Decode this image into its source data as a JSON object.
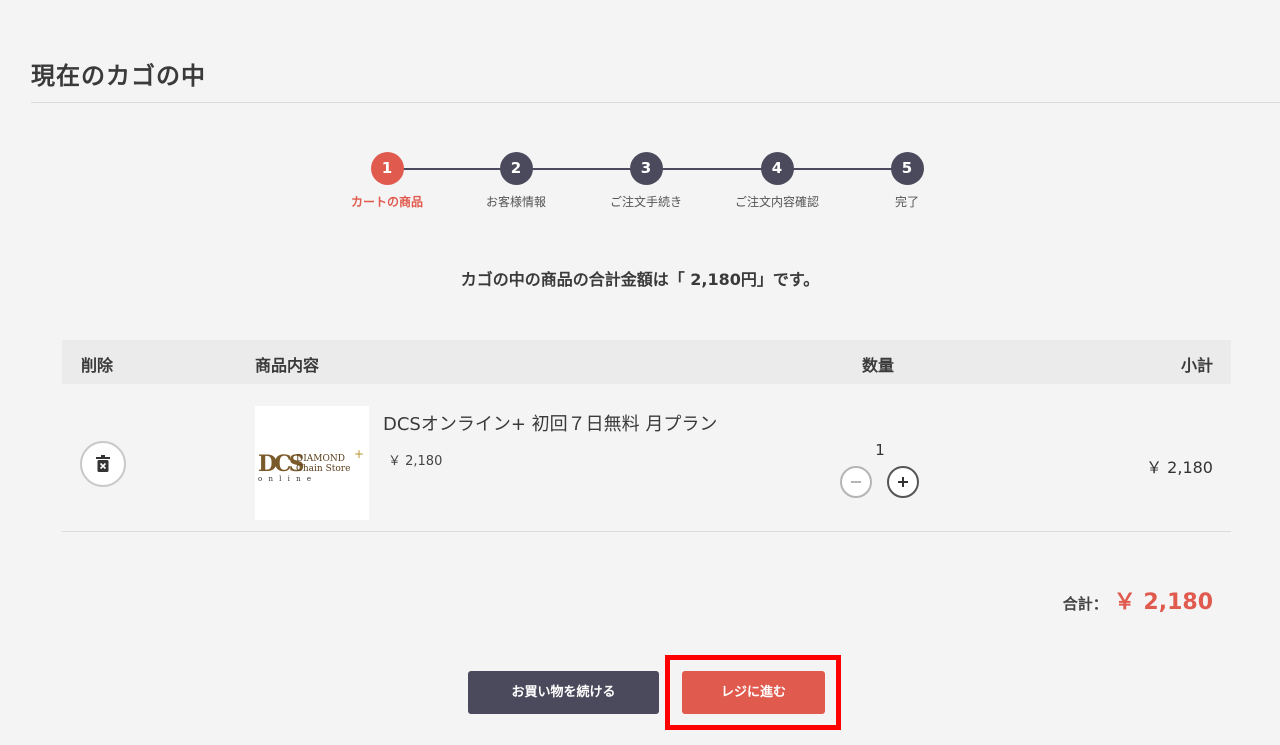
{
  "page": {
    "title": "現在のカゴの中"
  },
  "stepper": {
    "steps": [
      {
        "number": "1",
        "label": "カートの商品"
      },
      {
        "number": "2",
        "label": "お客様情報"
      },
      {
        "number": "3",
        "label": "ご注文手続き"
      },
      {
        "number": "4",
        "label": "ご注文内容確認"
      },
      {
        "number": "5",
        "label": "完了"
      }
    ],
    "active_step": 1
  },
  "summary_message": "カゴの中の商品の合計金額は「 2,180円」です。",
  "cart": {
    "headers": {
      "delete": "削除",
      "item": "商品内容",
      "quantity": "数量",
      "subtotal": "小計"
    },
    "items": [
      {
        "name": "DCSオンライン+ 初回７日無料 月プラン",
        "unit_price": "￥ 2,180",
        "quantity": "1",
        "subtotal": "￥ 2,180",
        "logo": {
          "brand": "DCS",
          "line1": "DIAMOND",
          "plus": "+",
          "line2": "Chain Store",
          "line3": "o n l i n e"
        }
      }
    ]
  },
  "total": {
    "label": "合計：",
    "value": "￥ 2,180"
  },
  "buttons": {
    "continue": "お買い物を続ける",
    "checkout": "レジに進む"
  },
  "colors": {
    "accent": "#e05a4e",
    "dark": "#4b4a5c",
    "highlight": "#ff0000"
  }
}
